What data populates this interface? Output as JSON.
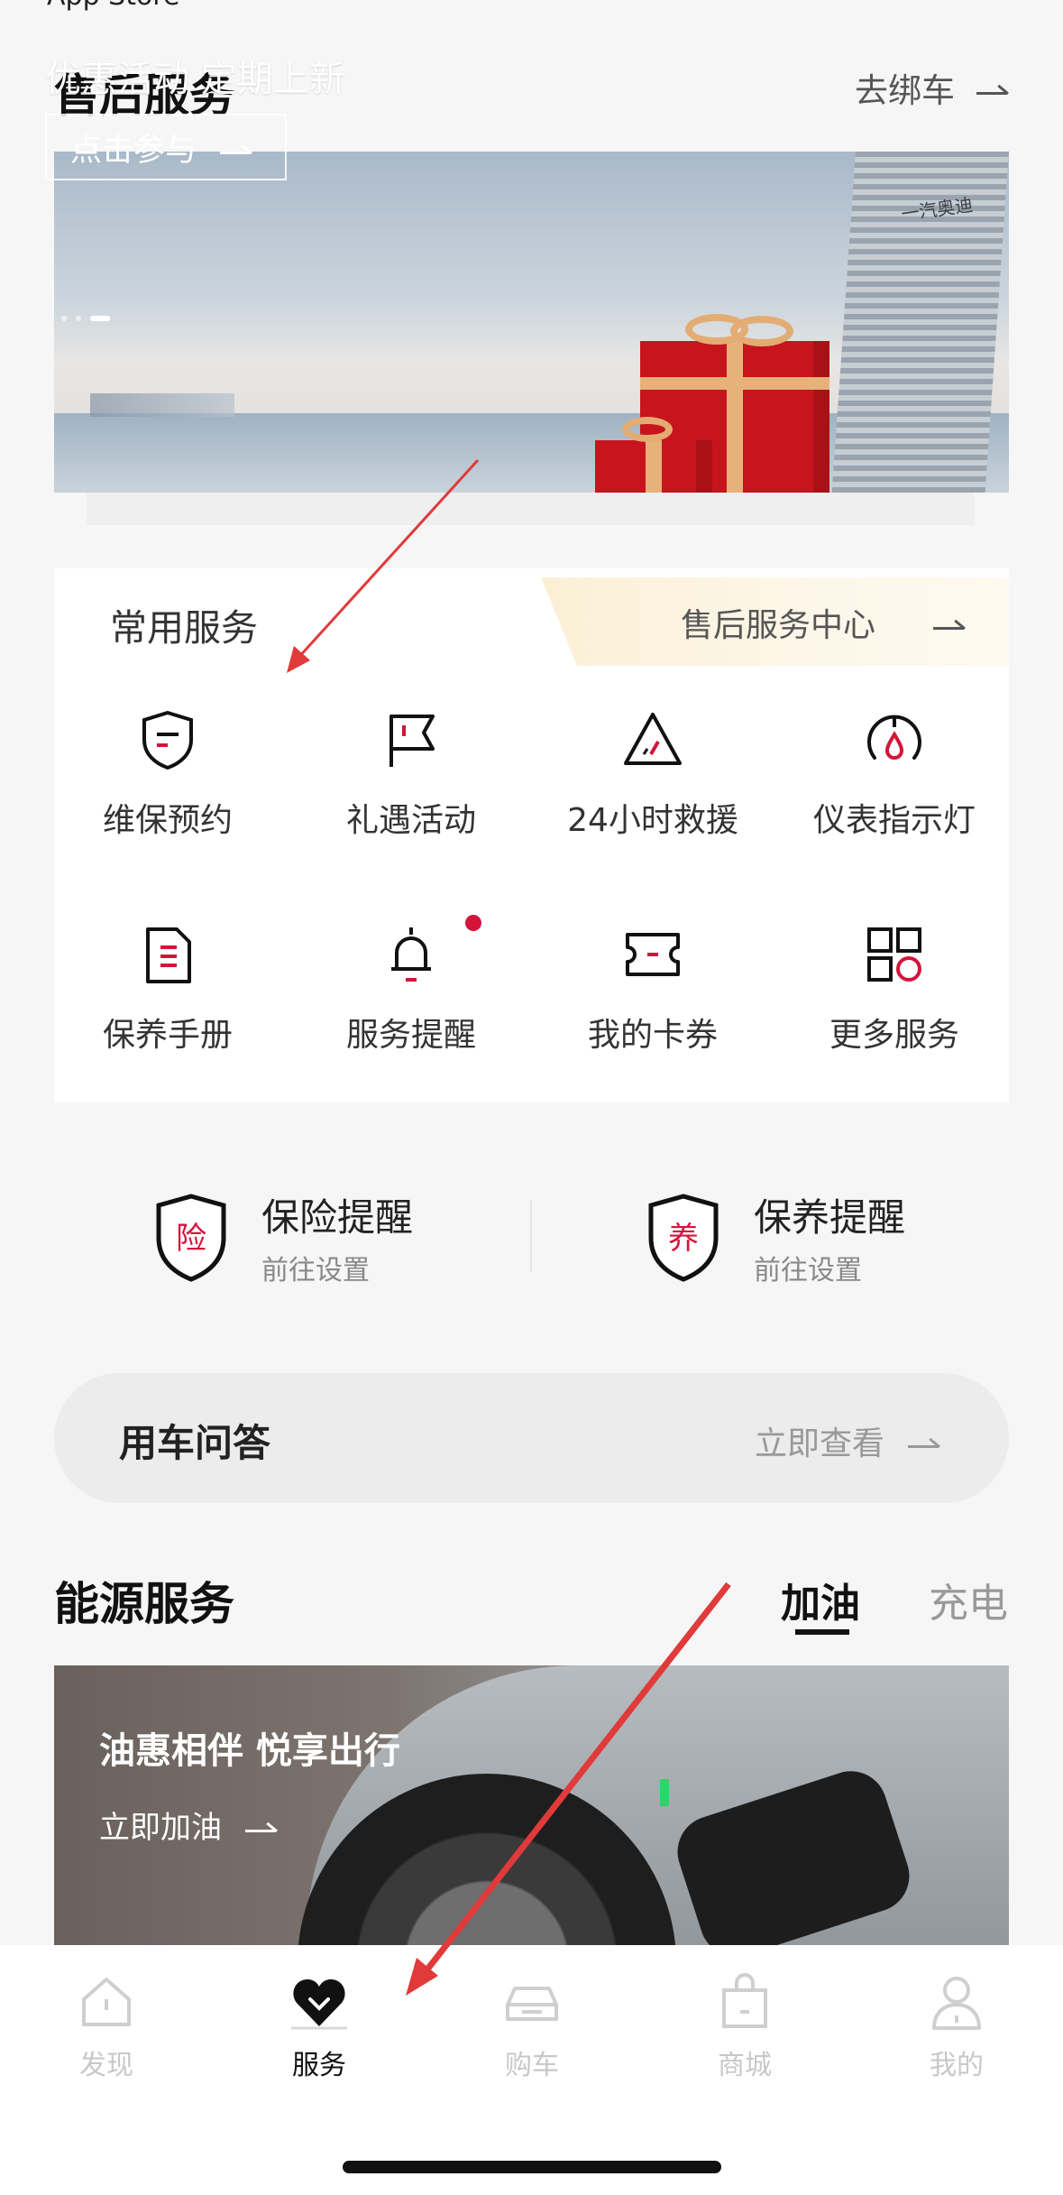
{
  "status": {
    "back_label": "App Store"
  },
  "after_sales": {
    "title": "售后服务",
    "unbind_label": "去绑车"
  },
  "banner": {
    "title": "优惠活动 定期上新",
    "button_label": "点击参与",
    "building_sign": "一汽奥迪"
  },
  "common_services": {
    "title": "常用服务",
    "center_link": "售后服务中心",
    "items": [
      {
        "label": "维保预约",
        "icon": "shield-doc-icon"
      },
      {
        "label": "礼遇活动",
        "icon": "flag-icon"
      },
      {
        "label": "24小时救援",
        "icon": "warning-triangle-icon"
      },
      {
        "label": "仪表指示灯",
        "icon": "gauge-drop-icon"
      },
      {
        "label": "保养手册",
        "icon": "manual-icon"
      },
      {
        "label": "服务提醒",
        "icon": "bell-icon"
      },
      {
        "label": "我的卡券",
        "icon": "ticket-icon"
      },
      {
        "label": "更多服务",
        "icon": "grid-icon"
      }
    ]
  },
  "reminders": [
    {
      "badge": "险",
      "title": "保险提醒",
      "subtitle": "前往设置"
    },
    {
      "badge": "养",
      "title": "保养提醒",
      "subtitle": "前往设置"
    }
  ],
  "qa": {
    "title": "用车问答",
    "link": "立即查看"
  },
  "energy": {
    "title": "能源服务",
    "tabs": [
      "加油",
      "充电"
    ],
    "active_tab": "加油",
    "card_title": "油惠相伴 悦享出行",
    "card_button": "立即加油"
  },
  "bottom_nav": [
    {
      "label": "发现",
      "icon": "home-icon",
      "active": false
    },
    {
      "label": "服务",
      "icon": "heart-icon",
      "active": true
    },
    {
      "label": "购车",
      "icon": "car-icon",
      "active": false
    },
    {
      "label": "商城",
      "icon": "bag-icon",
      "active": false
    },
    {
      "label": "我的",
      "icon": "user-icon",
      "active": false
    }
  ],
  "colors": {
    "accent": "#d4143a",
    "annotation_arrow": "#e03a3a",
    "text_primary": "#111111",
    "text_muted": "#999999"
  }
}
